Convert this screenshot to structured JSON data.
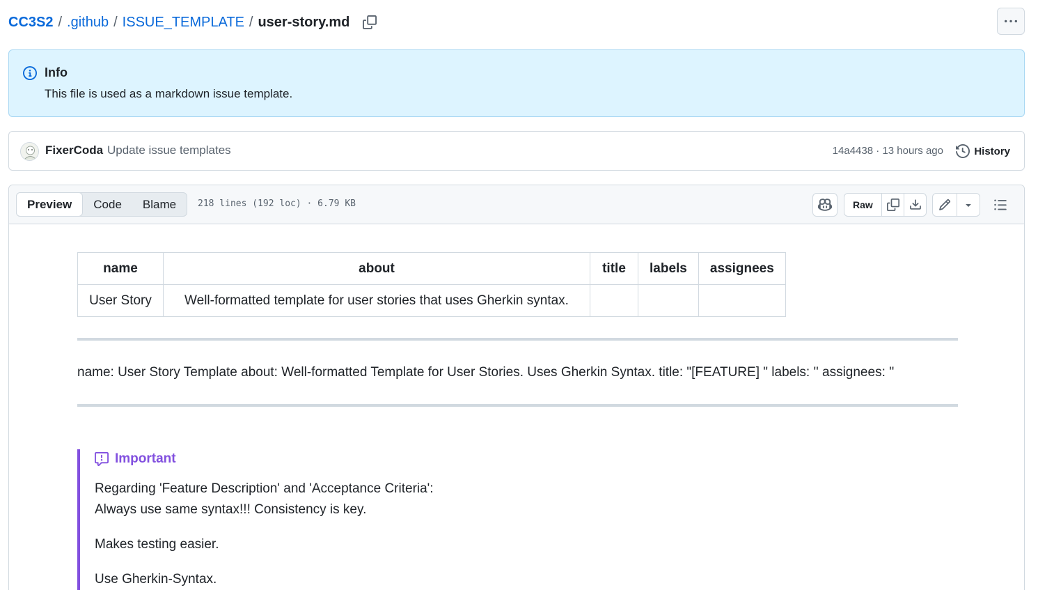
{
  "breadcrumb": {
    "repo": "CC3S2",
    "separator": "/",
    "folder1": ".github",
    "folder2": "ISSUE_TEMPLATE",
    "file": "user-story.md"
  },
  "info_banner": {
    "title": "Info",
    "text": "This file is used as a markdown issue template.",
    "icon": "info-icon"
  },
  "commit": {
    "author": "FixerCoda",
    "message": "Update issue templates",
    "sha": "14a4438",
    "dot": "·",
    "time": "13 hours ago",
    "history_label": "History"
  },
  "file_header": {
    "tabs": [
      "Preview",
      "Code",
      "Blame"
    ],
    "active_tab": "Preview",
    "info": "218 lines (192 loc) · 6.79 KB",
    "raw_label": "Raw"
  },
  "front_matter_table": {
    "headers": [
      "name",
      "about",
      "title",
      "labels",
      "assignees"
    ],
    "row": [
      "User Story",
      "Well-formatted template for user stories that uses Gherkin syntax.",
      "",
      "",
      ""
    ]
  },
  "front_matter_text": "name: User Story Template about: Well-formatted Template for User Stories. Uses Gherkin Syntax. title: \"[FEATURE] \" labels: '' assignees: ''",
  "important": {
    "title": "Important",
    "line1": "Regarding 'Feature Description' and 'Acceptance Criteria':",
    "line2": "Always use same syntax!!! Consistency is key.",
    "p2": "Makes testing easier.",
    "p3": "Use Gherkin-Syntax."
  },
  "colors": {
    "link": "#0969da",
    "info_bg": "#ddf4ff",
    "important": "#8250df",
    "border": "#d1d9e0"
  }
}
